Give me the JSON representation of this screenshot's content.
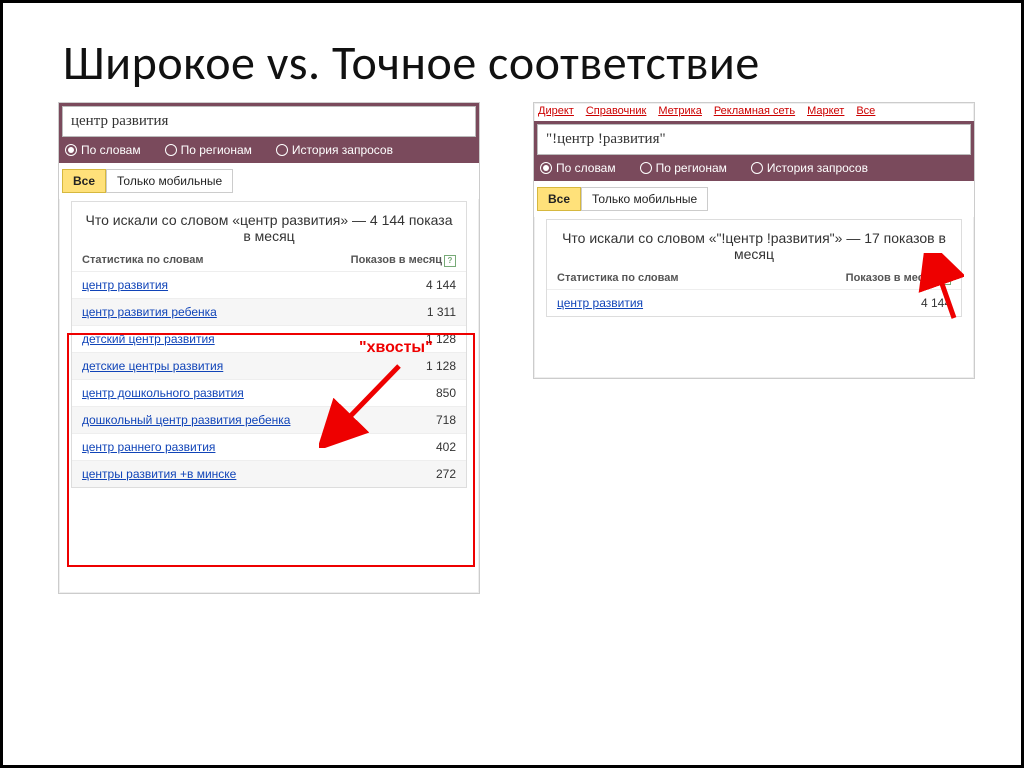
{
  "title": "Широкое vs. Точное соответствие",
  "left": {
    "search_value": "центр развития",
    "radio": {
      "words": "По словам",
      "regions": "По регионам",
      "history": "История запросов"
    },
    "tabs": {
      "all": "Все",
      "mobile": "Только мобильные"
    },
    "result_heading": "Что искали со словом «центр развития» — 4 144 показа в месяц",
    "stat_label": "Статистика по словам",
    "count_label": "Показов в месяц",
    "rows": [
      {
        "kw": "центр развития",
        "count": "4 144"
      },
      {
        "kw": "центр развития ребенка",
        "count": "1 311"
      },
      {
        "kw": "детский центр развития",
        "count": "1 128"
      },
      {
        "kw": "детские центры развития",
        "count": "1 128"
      },
      {
        "kw": "центр дошкольного развития",
        "count": "850"
      },
      {
        "kw": "дошкольный центр развития ребенка",
        "count": "718"
      },
      {
        "kw": "центр раннего развития",
        "count": "402"
      },
      {
        "kw": "центры развития +в минске",
        "count": "272"
      }
    ],
    "annotation": "\"хвосты\""
  },
  "right": {
    "topnav": [
      "Директ",
      "Справочник",
      "Метрика",
      "Рекламная сеть",
      "Маркет",
      "Все"
    ],
    "search_value": "\"!центр !развития\"",
    "radio": {
      "words": "По словам",
      "regions": "По регионам",
      "history": "История запросов"
    },
    "tabs": {
      "all": "Все",
      "mobile": "Только мобильные"
    },
    "result_heading": "Что искали со словом «\"!центр !развития\"» — 17 показов в месяц",
    "stat_label": "Статистика по словам",
    "count_label": "Показов в месяц",
    "rows": [
      {
        "kw": "центр развития",
        "count": "4 144"
      }
    ]
  }
}
